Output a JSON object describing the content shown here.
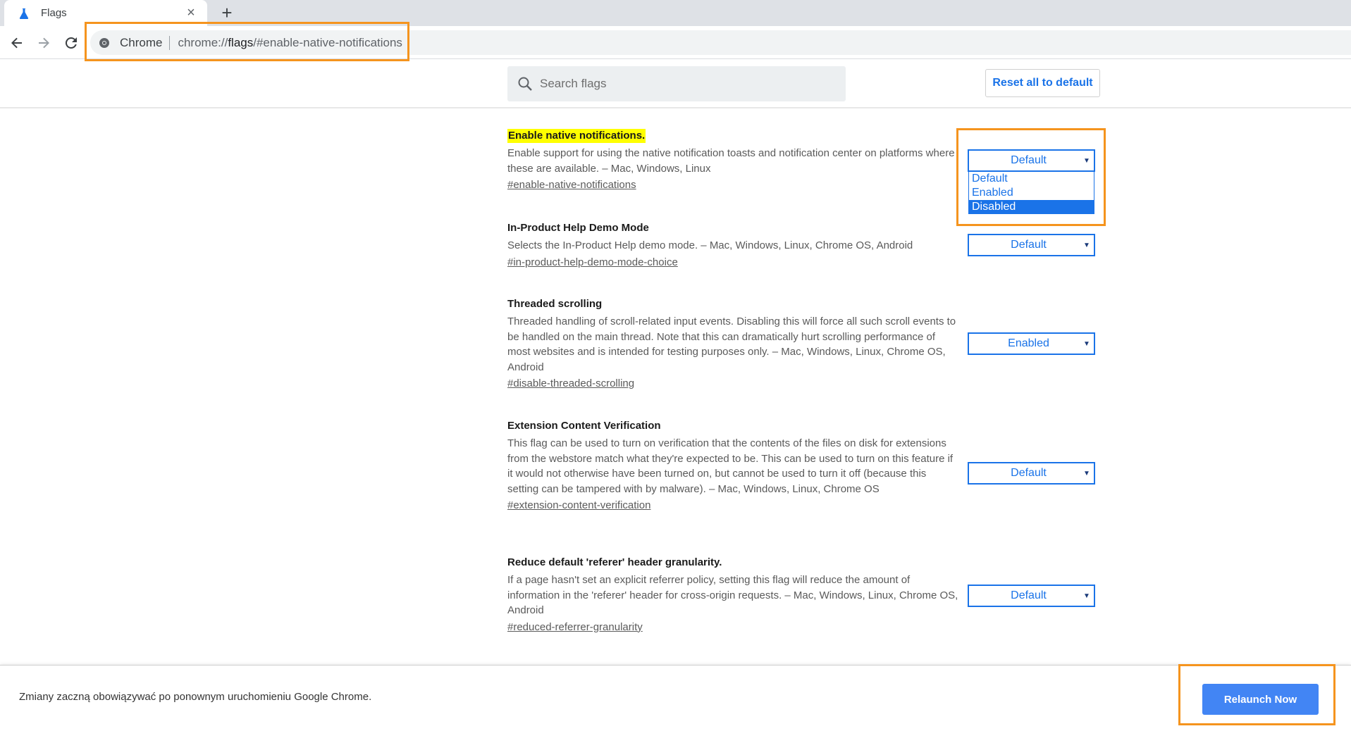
{
  "browser": {
    "tab_title": "Flags",
    "new_tab_symbol": "+",
    "close_symbol": "×",
    "omnibox_chip": "Chrome",
    "url_scheme": "chrome://",
    "url_host": "flags",
    "url_rest": "/#enable-native-notifications"
  },
  "header": {
    "search_placeholder": "Search flags",
    "reset_label": "Reset all to default"
  },
  "flags": [
    {
      "title": "Enable native notifications.",
      "description": "Enable support for using the native notification toasts and notification center on platforms where these are available. – Mac, Windows, Linux",
      "link": "#enable-native-notifications",
      "value": "Default",
      "highlighted": true
    },
    {
      "title": "In-Product Help Demo Mode",
      "description": "Selects the In-Product Help demo mode. – Mac, Windows, Linux, Chrome OS, Android",
      "link": "#in-product-help-demo-mode-choice",
      "value": "Default"
    },
    {
      "title": "Threaded scrolling",
      "description": "Threaded handling of scroll-related input events. Disabling this will force all such scroll events to be handled on the main thread. Note that this can dramatically hurt scrolling performance of most websites and is intended for testing purposes only. – Mac, Windows, Linux, Chrome OS, Android",
      "link": "#disable-threaded-scrolling",
      "value": "Enabled"
    },
    {
      "title": "Extension Content Verification",
      "description": "This flag can be used to turn on verification that the contents of the files on disk for extensions from the webstore match what they're expected to be. This can be used to turn on this feature if it would not otherwise have been turned on, but cannot be used to turn it off (because this setting can be tampered with by malware). – Mac, Windows, Linux, Chrome OS",
      "link": "#extension-content-verification",
      "value": "Default"
    },
    {
      "title": "Reduce default 'referer' header granularity.",
      "description": "If a page hasn't set an explicit referrer policy, setting this flag will reduce the amount of information in the 'referer' header for cross-origin requests. – Mac, Windows, Linux, Chrome OS, Android",
      "link": "#reduced-referrer-granularity",
      "value": "Default"
    }
  ],
  "dropdown": {
    "options": [
      "Default",
      "Enabled",
      "Disabled"
    ],
    "highlighted_option": "Disabled"
  },
  "bottom_bar": {
    "message": "Zmiany zaczną obowiązywać po ponownym uruchomieniu Google Chrome.",
    "relaunch_label": "Relaunch Now"
  },
  "colors": {
    "accent": "#1a73e8",
    "annotation": "#f5941e",
    "highlight": "#ffff00",
    "relaunch": "#4285f4"
  }
}
